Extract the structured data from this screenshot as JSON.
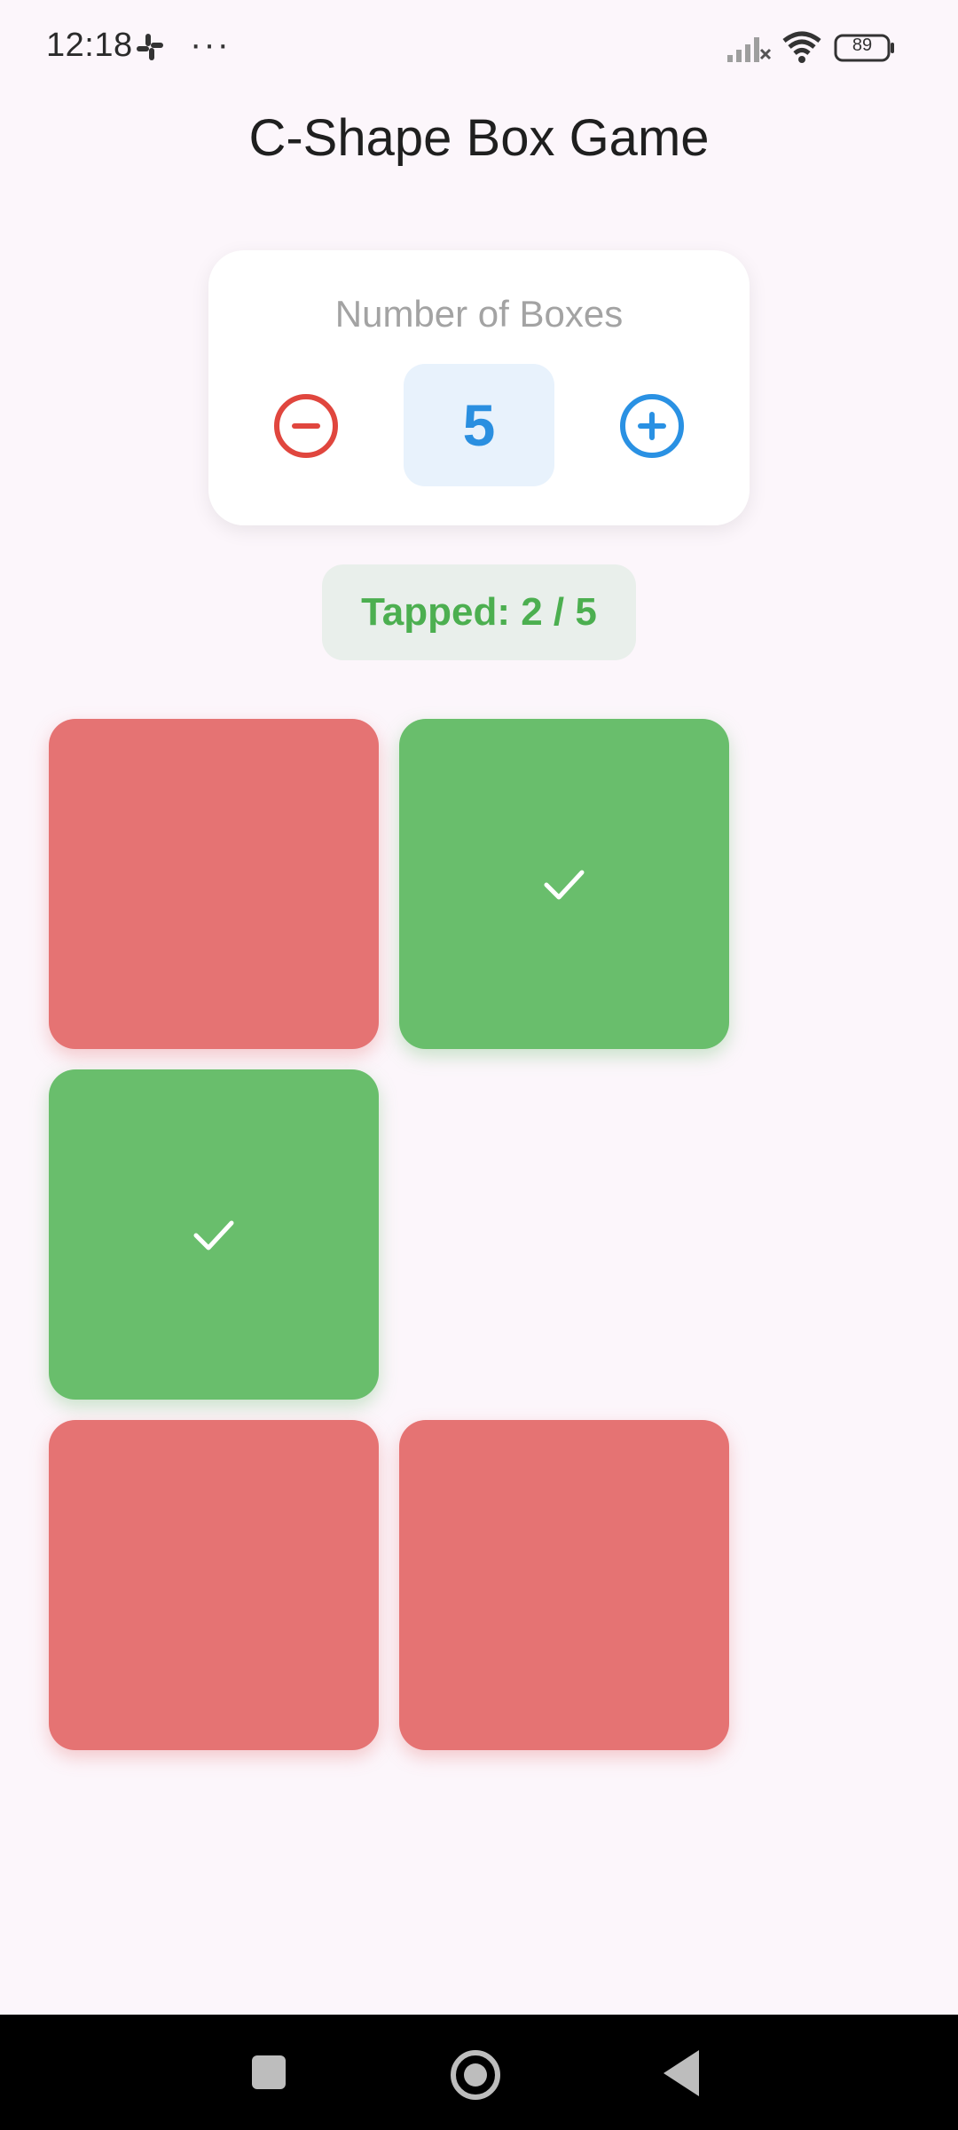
{
  "status_bar": {
    "time": "12:18",
    "more": "···",
    "battery": "89"
  },
  "title": "C-Shape Box Game",
  "counter": {
    "label": "Number of Boxes",
    "value": "5",
    "decrement_icon": "minus-circle-icon",
    "increment_icon": "plus-circle-icon"
  },
  "tapped_status": "Tapped: 2 / 5",
  "boxes": [
    {
      "state": "untapped",
      "color": "#e57373"
    },
    {
      "state": "tapped",
      "color": "#69be6c",
      "icon": "check-icon"
    },
    {
      "state": "tapped",
      "color": "#69be6c",
      "icon": "check-icon"
    },
    {
      "state": "untapped",
      "color": "#e57373"
    },
    {
      "state": "untapped",
      "color": "#e57373"
    }
  ],
  "colors": {
    "accent_blue": "#2a91e3",
    "accent_red": "#e0463e",
    "success_green": "#4caf50",
    "background": "#fcf6fb"
  },
  "nav": {
    "recents": "recents-icon",
    "home": "home-icon",
    "back": "back-icon"
  }
}
